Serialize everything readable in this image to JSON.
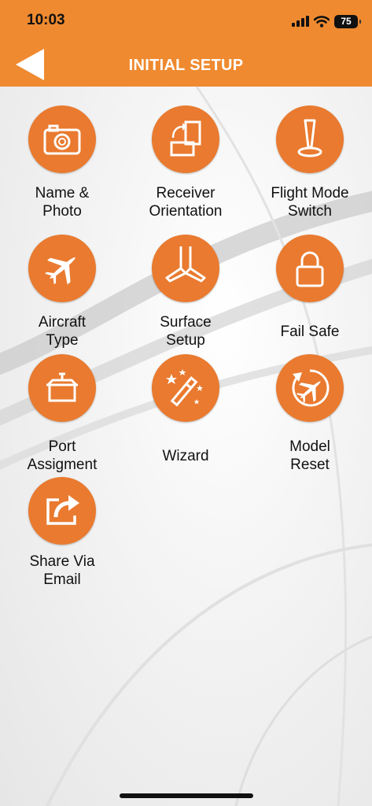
{
  "status_bar": {
    "time": "10:03",
    "battery": "75"
  },
  "header": {
    "title": "INITIAL SETUP"
  },
  "colors": {
    "accent": "#ef8a30",
    "icon_circle": "#e97a2f"
  },
  "tiles": [
    {
      "label": "Name &\nPhoto",
      "icon": "camera-icon"
    },
    {
      "label": "Receiver\nOrientation",
      "icon": "rotate-device-icon"
    },
    {
      "label": "Flight Mode\nSwitch",
      "icon": "switch-icon"
    },
    {
      "label": "Aircraft\nType",
      "icon": "airplane-icon"
    },
    {
      "label": "Surface\nSetup",
      "icon": "wing-surface-icon"
    },
    {
      "label": "Fail Safe",
      "icon": "lock-icon"
    },
    {
      "label": "Port\nAssigment",
      "icon": "port-icon"
    },
    {
      "label": "Wizard",
      "icon": "magic-wand-icon"
    },
    {
      "label": "Model\nReset",
      "icon": "reset-airplane-icon"
    },
    {
      "label": "Share Via\nEmail",
      "icon": "share-icon"
    }
  ]
}
